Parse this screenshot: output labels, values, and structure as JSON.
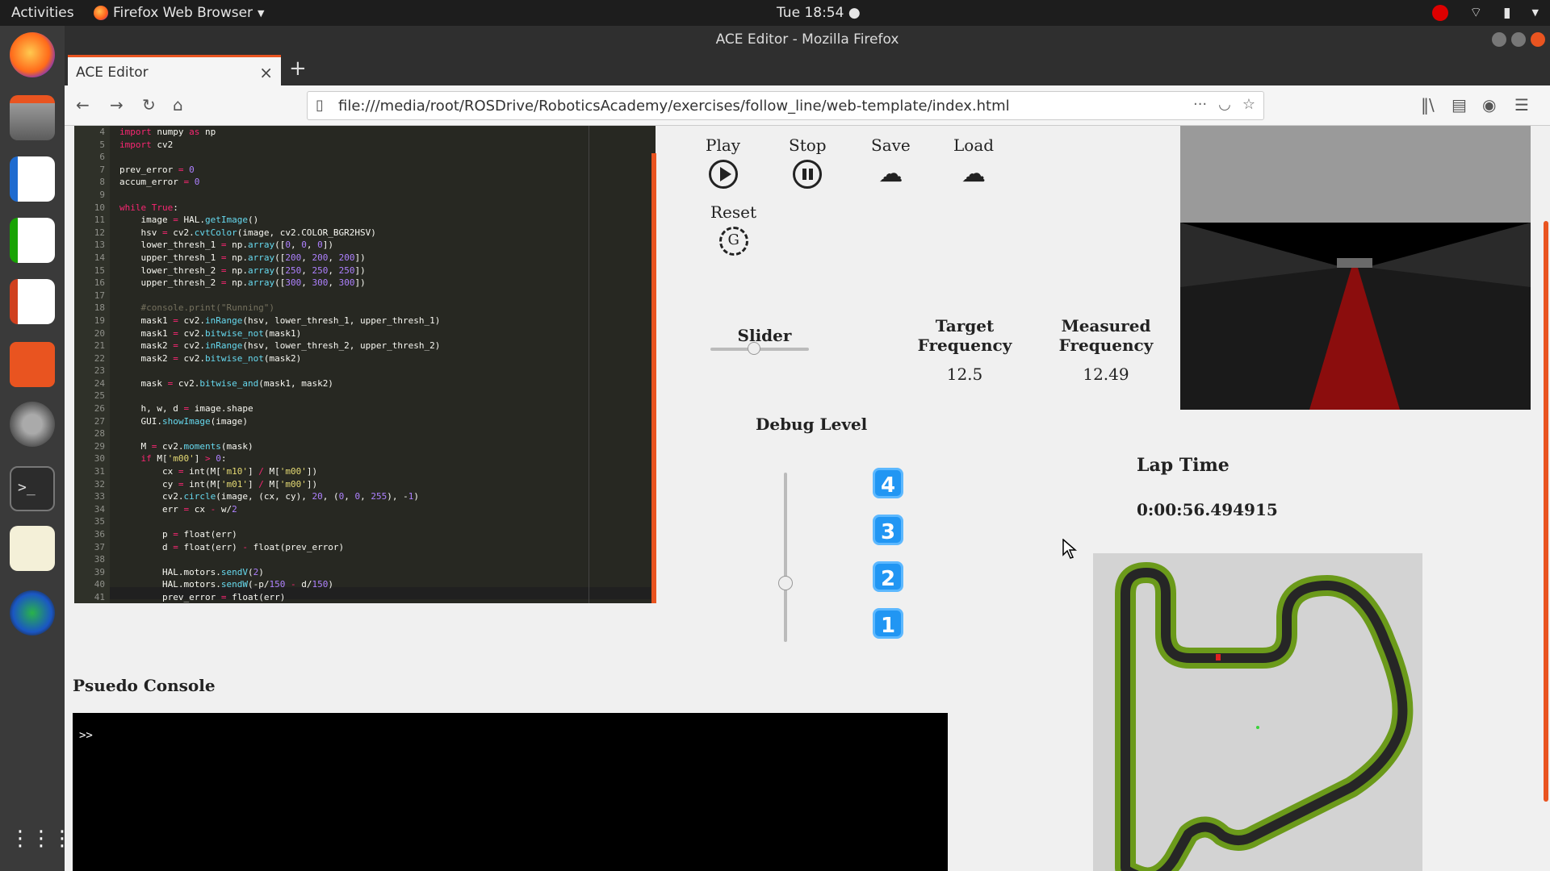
{
  "topbar": {
    "activities": "Activities",
    "app_name": "Firefox Web Browser",
    "clock": "Tue 18:54"
  },
  "window": {
    "title": "ACE Editor - Mozilla Firefox"
  },
  "tab": {
    "label": "ACE Editor"
  },
  "address_bar": {
    "url": "file:///media/root/ROSDrive/RoboticsAcademy/exercises/follow_line/web-template/index.html"
  },
  "editor": {
    "line_numbers": [
      "4",
      "5",
      "6",
      "7",
      "8",
      "9",
      "10",
      "11",
      "12",
      "13",
      "14",
      "15",
      "16",
      "17",
      "18",
      "19",
      "20",
      "21",
      "22",
      "23",
      "24",
      "25",
      "26",
      "27",
      "28",
      "29",
      "30",
      "31",
      "32",
      "33",
      "34",
      "35",
      "36",
      "37",
      "38",
      "39",
      "40",
      "41"
    ],
    "lines": [
      "import numpy as np",
      "import cv2",
      "",
      "prev_error = 0",
      "accum_error = 0",
      "",
      "while True:",
      "    image = HAL.getImage()",
      "    hsv = cv2.cvtColor(image, cv2.COLOR_BGR2HSV)",
      "    lower_thresh_1 = np.array([0, 0, 0])",
      "    upper_thresh_1 = np.array([200, 200, 200])",
      "    lower_thresh_2 = np.array([250, 250, 250])",
      "    upper_thresh_2 = np.array([300, 300, 300])",
      "",
      "    #console.print(\"Running\")",
      "    mask1 = cv2.inRange(hsv, lower_thresh_1, upper_thresh_1)",
      "    mask1 = cv2.bitwise_not(mask1)",
      "    mask2 = cv2.inRange(hsv, lower_thresh_2, upper_thresh_2)",
      "    mask2 = cv2.bitwise_not(mask2)",
      "",
      "    mask = cv2.bitwise_and(mask1, mask2)",
      "",
      "    h, w, d = image.shape",
      "    GUI.showImage(image)",
      "",
      "    M = cv2.moments(mask)",
      "    if M['m00'] > 0:",
      "        cx = int(M['m10'] / M['m00'])",
      "        cy = int(M['m01'] / M['m00'])",
      "        cv2.circle(image, (cx, cy), 20, (0, 0, 255), -1)",
      "        err = cx - w/2",
      "",
      "        p = float(err)",
      "        d = float(err) - float(prev_error)",
      "",
      "        HAL.motors.sendV(2)",
      "        HAL.motors.sendW(-p/150 - d/150)",
      "        prev_error = float(err)"
    ]
  },
  "controls": {
    "play": "Play",
    "stop": "Stop",
    "save": "Save",
    "load": "Load",
    "reset": "Reset"
  },
  "slider": {
    "label": "Slider",
    "value": 0.4
  },
  "target_frequency": {
    "label_1": "Target",
    "label_2": "Frequency",
    "value": "12.5"
  },
  "measured_frequency": {
    "label_1": "Measured",
    "label_2": "Frequency",
    "value": "12.49"
  },
  "debug": {
    "label": "Debug Level",
    "levels": [
      "4",
      "3",
      "2",
      "1"
    ],
    "value": 0.4
  },
  "lap_time": {
    "label": "Lap Time",
    "value": "0:00:56.494915"
  },
  "console": {
    "title": "Psuedo Console",
    "prompt": ">>"
  },
  "colors": {
    "accent": "#e95420",
    "level_badge": "#2196f3",
    "editor_bg": "#272822",
    "track_green": "#6b9a1a",
    "track_dark": "#262626"
  },
  "icons": [
    "firefox-icon",
    "files-icon",
    "writer-icon",
    "calc-icon",
    "impress-icon",
    "software-icon",
    "settings-icon",
    "terminal-icon",
    "text-editor-icon",
    "app-icon",
    "show-apps-icon"
  ]
}
